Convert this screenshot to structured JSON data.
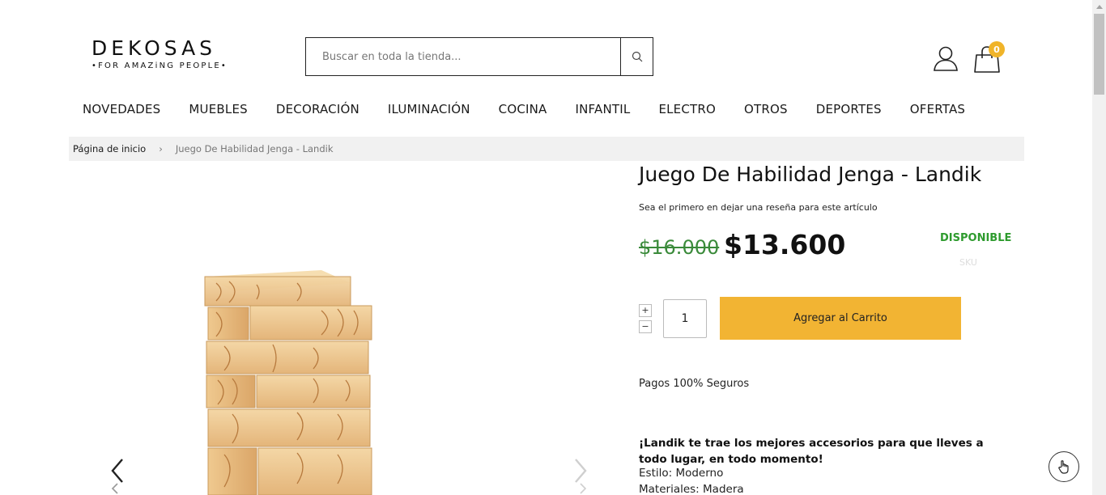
{
  "header": {
    "logo_main": "DEKOSAS",
    "logo_sub": "•FOR AMAZiNG PEOPLE•",
    "search_placeholder": "Buscar en toda la tienda...",
    "cart_count": "0"
  },
  "nav": {
    "items": [
      {
        "label": "NOVEDADES"
      },
      {
        "label": "MUEBLES"
      },
      {
        "label": "DECORACIÓN"
      },
      {
        "label": "ILUMINACIÓN"
      },
      {
        "label": "COCINA"
      },
      {
        "label": "INFANTIL"
      },
      {
        "label": "ELECTRO"
      },
      {
        "label": "OTROS"
      },
      {
        "label": "DEPORTES"
      },
      {
        "label": "OFERTAS"
      }
    ]
  },
  "breadcrumb": {
    "home": "Página de inicio",
    "separator": "›",
    "current": "Juego De Habilidad Jenga - Landik"
  },
  "product": {
    "title": "Juego De Habilidad Jenga - Landik",
    "review_link": "Sea el primero en dejar una reseña para este artículo",
    "old_price": "$16.000",
    "new_price": "$13.600",
    "availability": "DISPONIBLE",
    "sku_label": "SKU",
    "quantity": "1",
    "qty_plus": "+",
    "qty_minus": "−",
    "add_to_cart": "Agregar al Carrito",
    "secure_payments": "Pagos 100% Seguros",
    "description_bold": "¡Landik te trae los mejores accesorios para que lleves a todo lugar, en todo momento!",
    "style": "Estilo: Moderno",
    "materials": "Materiales: Madera"
  },
  "colors": {
    "accent": "#f2b433",
    "price_old": "#3a8a3a",
    "available": "#2e9b2e",
    "cart_badge": "#f0b429"
  },
  "icons": {
    "search": "search-icon",
    "account": "user-icon",
    "cart": "shopping-bag-icon",
    "prev": "chevron-left-icon",
    "next": "chevron-right-icon",
    "accessibility": "hand-pointer-icon"
  }
}
